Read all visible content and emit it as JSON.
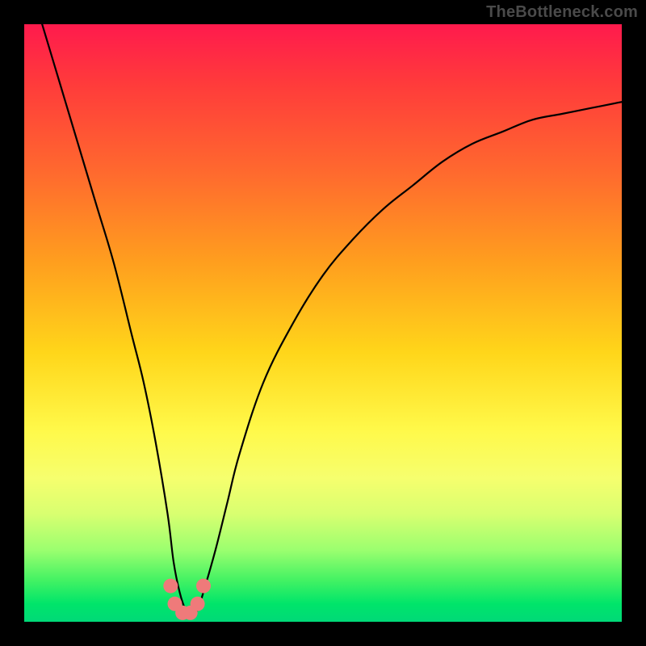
{
  "watermark": "TheBottleneck.com",
  "chart_data": {
    "type": "line",
    "title": "",
    "xlabel": "",
    "ylabel": "",
    "xlim": [
      0,
      100
    ],
    "ylim": [
      0,
      100
    ],
    "grid": false,
    "series": [
      {
        "name": "curve",
        "color": "#000000",
        "x": [
          3,
          6,
          9,
          12,
          15,
          18,
          20,
          22,
          24,
          25,
          26,
          27,
          28,
          29,
          30,
          32,
          34,
          36,
          40,
          45,
          50,
          55,
          60,
          65,
          70,
          75,
          80,
          85,
          90,
          95,
          100
        ],
        "y": [
          100,
          90,
          80,
          70,
          60,
          48,
          40,
          30,
          18,
          10,
          5,
          2,
          1,
          2,
          5,
          12,
          20,
          28,
          40,
          50,
          58,
          64,
          69,
          73,
          77,
          80,
          82,
          84,
          85,
          86,
          87
        ]
      }
    ],
    "markers": {
      "name": "trough-dots",
      "color": "#ef7a7a",
      "points": [
        {
          "x": 24.5,
          "y": 6
        },
        {
          "x": 25.2,
          "y": 3
        },
        {
          "x": 26.5,
          "y": 1.5
        },
        {
          "x": 27.8,
          "y": 1.5
        },
        {
          "x": 29.0,
          "y": 3
        },
        {
          "x": 30.0,
          "y": 6
        }
      ]
    },
    "background": {
      "type": "vertical-gradient",
      "stops": [
        {
          "pos": 0.0,
          "color": "#ff1a4d"
        },
        {
          "pos": 0.55,
          "color": "#ffd61a"
        },
        {
          "pos": 0.76,
          "color": "#f6ff6e"
        },
        {
          "pos": 1.0,
          "color": "#00d978"
        }
      ]
    }
  }
}
